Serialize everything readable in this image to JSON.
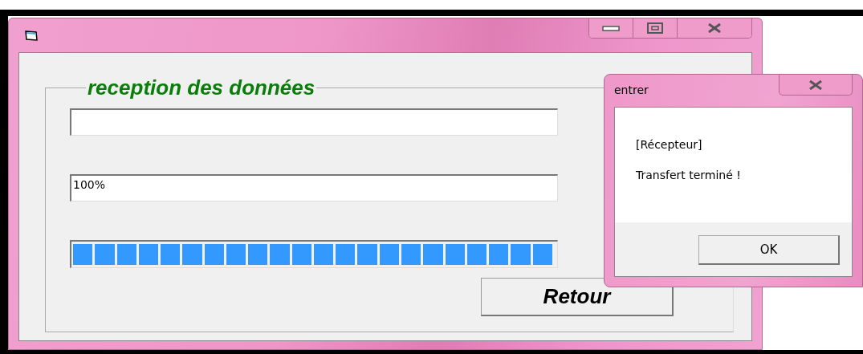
{
  "main_window": {
    "group": {
      "legend": "reception des données"
    },
    "fields": [
      {
        "kind": "text"
      },
      {
        "kind": "text",
        "value": "100%"
      }
    ],
    "progress": {
      "level": 1
    },
    "button": "Retour"
  },
  "dialog": {
    "title": "entrer",
    "lines": [
      "[Récepteur]",
      "Transfert terminé !"
    ],
    "button": "OK"
  }
}
